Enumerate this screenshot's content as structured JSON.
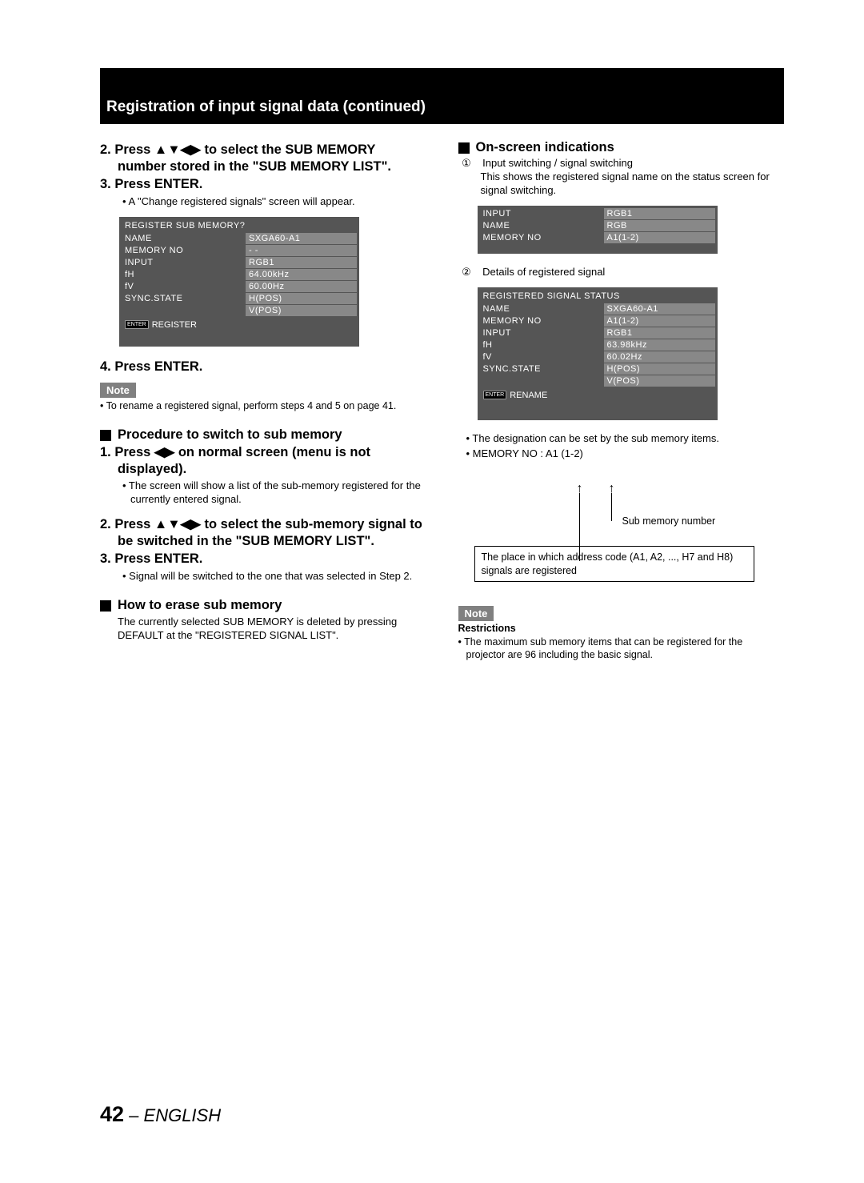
{
  "header": {
    "title": "Registration of input signal data (continued)"
  },
  "left": {
    "step2": "2.  Press ▲▼◀▶ to select the SUB MEMORY number stored in the \"SUB MEMORY LIST\".",
    "step3": "3.  Press ENTER.",
    "step3_bullet": "• A \"Change registered signals\" screen will appear.",
    "osd1": {
      "title": "REGISTER SUB MEMORY?",
      "rows": [
        [
          "NAME",
          "SXGA60-A1"
        ],
        [
          "MEMORY NO",
          "- -"
        ],
        [
          "INPUT",
          "RGB1"
        ],
        [
          "fH",
          "64.00kHz"
        ],
        [
          "fV",
          "60.00Hz"
        ],
        [
          "SYNC.STATE",
          "H(POS)"
        ],
        [
          "",
          "V(POS)"
        ]
      ],
      "footer_key": "ENTER",
      "footer_label": "REGISTER"
    },
    "step4": "4.  Press ENTER.",
    "note_label": "Note",
    "note4": "• To rename a registered signal, perform steps 4 and 5 on page 41.",
    "sec_switch": "Procedure to switch to sub memory",
    "sw_step1": "1.  Press ◀▶ on normal screen (menu is not displayed).",
    "sw_step1_b": "• The screen will show a list of the sub-memory registered for the currently entered signal.",
    "sw_step2": "2.  Press ▲▼◀▶ to select the sub-memory signal to be switched in the \"SUB MEMORY LIST\".",
    "sw_step3": "3.  Press ENTER.",
    "sw_step3_b": "• Signal will be switched to the one that was selected in Step 2.",
    "sec_erase": "How to erase sub memory",
    "erase_body": "The currently selected SUB MEMORY is deleted by pressing DEFAULT at the \"REGISTERED SIGNAL LIST\"."
  },
  "right": {
    "sec_on": "On-screen indications",
    "num1": "①",
    "num1_title": "Input switching / signal switching",
    "num1_body": "This shows the registered signal name on the status screen for signal switching.",
    "osd2": {
      "rows": [
        [
          "INPUT",
          "RGB1"
        ],
        [
          "NAME",
          "RGB"
        ],
        [
          "MEMORY NO",
          "A1(1-2)"
        ]
      ]
    },
    "num2": "②",
    "num2_title": "Details of registered signal",
    "osd3": {
      "title": "REGISTERED SIGNAL STATUS",
      "rows": [
        [
          "NAME",
          "SXGA60-A1"
        ],
        [
          "MEMORY NO",
          "A1(1-2)"
        ],
        [
          "INPUT",
          "RGB1"
        ],
        [
          "fH",
          "63.98kHz"
        ],
        [
          "fV",
          "60.02Hz"
        ],
        [
          "SYNC.STATE",
          "H(POS)"
        ],
        [
          "",
          "V(POS)"
        ]
      ],
      "footer_key": "ENTER",
      "footer_label": "RENAME"
    },
    "bullet1": "• The designation can be set by the sub memory items.",
    "bullet2": "• MEMORY NO : A1 (1-2)",
    "diag_sub": "Sub memory number",
    "diag_box": "The place in which address code (A1, A2, ..., H7 and H8) signals are registered",
    "note_label": "Note",
    "restrictions": "Restrictions",
    "rest_b": "• The maximum sub memory items that can be registered for the projector are 96 including the basic signal."
  },
  "footer": {
    "page": "42",
    "sep": " – ",
    "lang": "ENGLISH"
  }
}
